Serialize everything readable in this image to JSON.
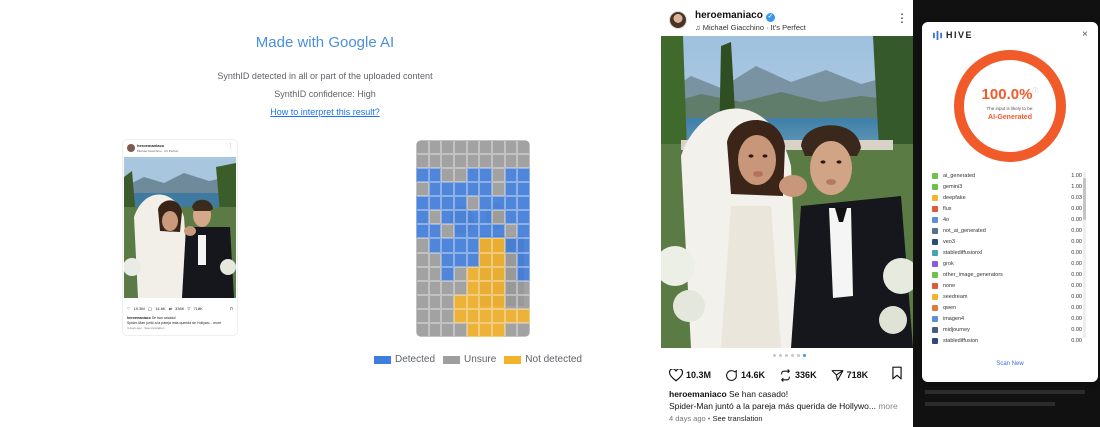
{
  "synthid": {
    "title": "Made with Google AI",
    "line1": "SynthID detected in all or part of the uploaded content",
    "line2": "SynthID confidence: High",
    "link": "How to interpret this result?",
    "legend": [
      {
        "label": "Detected",
        "color": "#3d7ee0"
      },
      {
        "label": "Unsure",
        "color": "#9e9e9e"
      },
      {
        "label": "Not detected",
        "color": "#f3b32a"
      }
    ]
  },
  "thumbnail": {
    "user": "heroemaniaco",
    "audio": "Michael Giacchino · It's Perfect",
    "likes": "10.3M",
    "comments": "14.6K",
    "reposts": "336K",
    "shares": "718K",
    "caption_user": "heroemaniaco",
    "caption_text": "Se han casado!",
    "caption_line2": "Spider-Man juntó a la pareja más querida de Hollywo... more",
    "time": "4 days ago · See translation"
  },
  "post": {
    "username": "heroemaniaco",
    "audio": "Michael Giacchino · It's Perfect",
    "likes": "10.3M",
    "comments": "14.6K",
    "reposts": "336K",
    "shares": "718K",
    "caption_user": "heroemaniaco",
    "caption_text": "Se han casado!",
    "caption_line2": "Spider-Man juntó a la pareja más querida de Hollywo...",
    "more": "more",
    "time": "4 days ago",
    "see_translation": "See translation"
  },
  "hive": {
    "brand": "HIVE",
    "close": "×",
    "percent": "100.0%",
    "subtitle": "The input is likely to be:",
    "verdict": "AI-Generated",
    "scan_new": "Scan New",
    "rows": [
      {
        "name": "ai_generated",
        "score": "1.00",
        "color": "#6cc24a"
      },
      {
        "name": "gemini3",
        "score": "1.00",
        "color": "#6cc24a"
      },
      {
        "name": "deepfake",
        "score": "0.03",
        "color": "#f3b32a"
      },
      {
        "name": "flux",
        "score": "0.00",
        "color": "#e05a3a"
      },
      {
        "name": "4o",
        "score": "0.00",
        "color": "#5b8fd8"
      },
      {
        "name": "not_ai_generated",
        "score": "0.00",
        "color": "#5b6f8a"
      },
      {
        "name": "veo3",
        "score": "0.00",
        "color": "#2f4a7a"
      },
      {
        "name": "stablediffusionxl",
        "score": "0.00",
        "color": "#4aa0b5"
      },
      {
        "name": "grok",
        "score": "0.00",
        "color": "#8a5bd8"
      },
      {
        "name": "other_image_generators",
        "score": "0.00",
        "color": "#6cc24a"
      },
      {
        "name": "none",
        "score": "0.00",
        "color": "#e05a3a"
      },
      {
        "name": "seedream",
        "score": "0.00",
        "color": "#f3b32a"
      },
      {
        "name": "qwen",
        "score": "0.00",
        "color": "#e07a3a"
      },
      {
        "name": "imagen4",
        "score": "0.00",
        "color": "#5b8fd8"
      },
      {
        "name": "midjourney",
        "score": "0.00",
        "color": "#4a5a7a"
      },
      {
        "name": "stablediffusion",
        "score": "0.00",
        "color": "#2f4a7a"
      }
    ]
  }
}
